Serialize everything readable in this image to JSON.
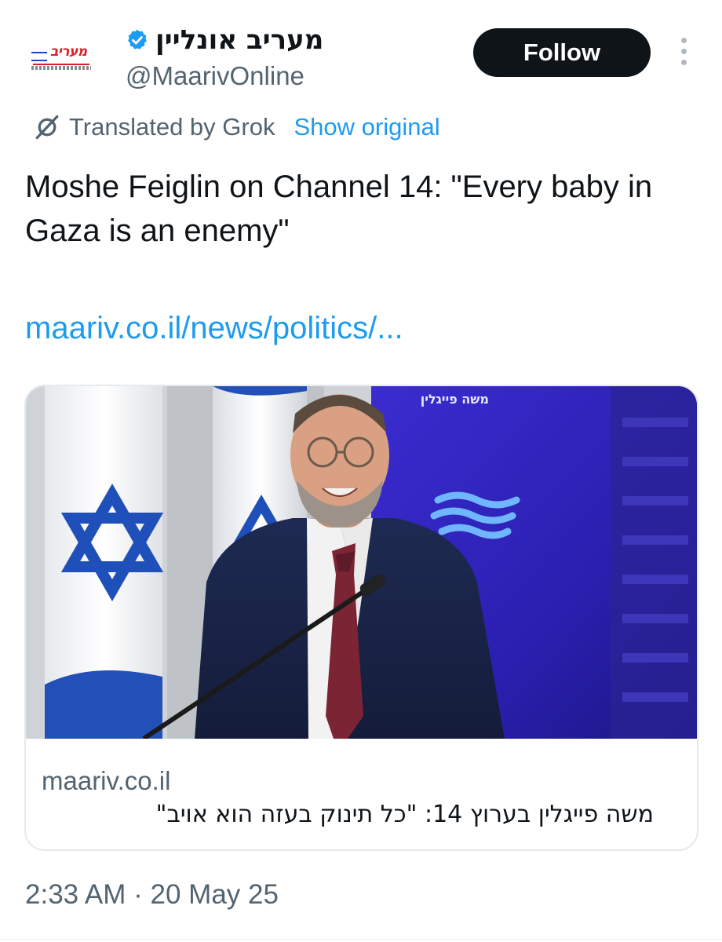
{
  "account": {
    "display_name": "מעריב אונליין",
    "handle": "@MaarivOnline",
    "avatar_logo_text": "מעריב",
    "avatar_logo_subtext": "עם המחפשים"
  },
  "follow_label": "Follow",
  "translation": {
    "label": "Translated by Grok",
    "show_original": "Show original"
  },
  "tweet": {
    "text": "Moshe Feiglin on Channel 14: \"Every baby in Gaza is an enemy\"",
    "link": "maariv.co.il/news/politics/..."
  },
  "card": {
    "backdrop_text": "משה פייגלין",
    "domain": "maariv.co.il",
    "title": "משה פייגלין בערוץ 14: \"כל תינוק בעזה הוא אויב\""
  },
  "timestamp": "2:33 AM · 20 May 25",
  "colors": {
    "accent": "#1d9bf0",
    "text": "#0f1419",
    "secondary": "#536471",
    "border": "#e4e9ed",
    "verified": "#1d9bf0"
  },
  "icons": [
    "verified-badge-icon",
    "more-options-icon",
    "grok-icon"
  ]
}
